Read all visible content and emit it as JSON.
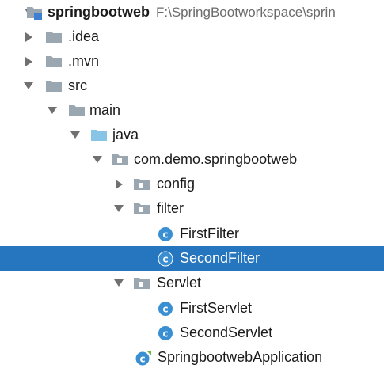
{
  "tree": {
    "root": {
      "label": "springbootweb",
      "path": "F:\\SpringBootworkspace\\sprin",
      "expanded": true,
      "icon": "module-folder-icon"
    },
    "idea": {
      "label": ".idea",
      "expanded": false,
      "icon": "folder-icon"
    },
    "mvn": {
      "label": ".mvn",
      "expanded": false,
      "icon": "folder-icon"
    },
    "src": {
      "label": "src",
      "expanded": true,
      "icon": "folder-icon"
    },
    "main": {
      "label": "main",
      "expanded": true,
      "icon": "folder-icon"
    },
    "java": {
      "label": "java",
      "expanded": true,
      "icon": "source-root-folder-icon"
    },
    "package": {
      "label": "com.demo.springbootweb",
      "expanded": true,
      "icon": "package-icon"
    },
    "config": {
      "label": "config",
      "expanded": false,
      "icon": "package-icon"
    },
    "filter": {
      "label": "filter",
      "expanded": true,
      "icon": "package-icon"
    },
    "first_filter": {
      "label": "FirstFilter",
      "icon": "class-icon"
    },
    "second_filter": {
      "label": "SecondFilter",
      "icon": "class-icon",
      "selected": true
    },
    "servlet": {
      "label": "Servlet",
      "expanded": true,
      "icon": "package-icon"
    },
    "first_servlet": {
      "label": "FirstServlet",
      "icon": "class-icon"
    },
    "second_servlet": {
      "label": "SecondServlet",
      "icon": "class-icon"
    },
    "application": {
      "label": "SpringbootwebApplication",
      "icon": "spring-boot-class-icon"
    }
  },
  "colors": {
    "selection": "#2675bf",
    "folder": "#9aa7b0",
    "source_folder": "#87c4e6",
    "class_icon": "#3a8fd3",
    "spring_badge": "#6db33f",
    "arrow": "#707070"
  }
}
